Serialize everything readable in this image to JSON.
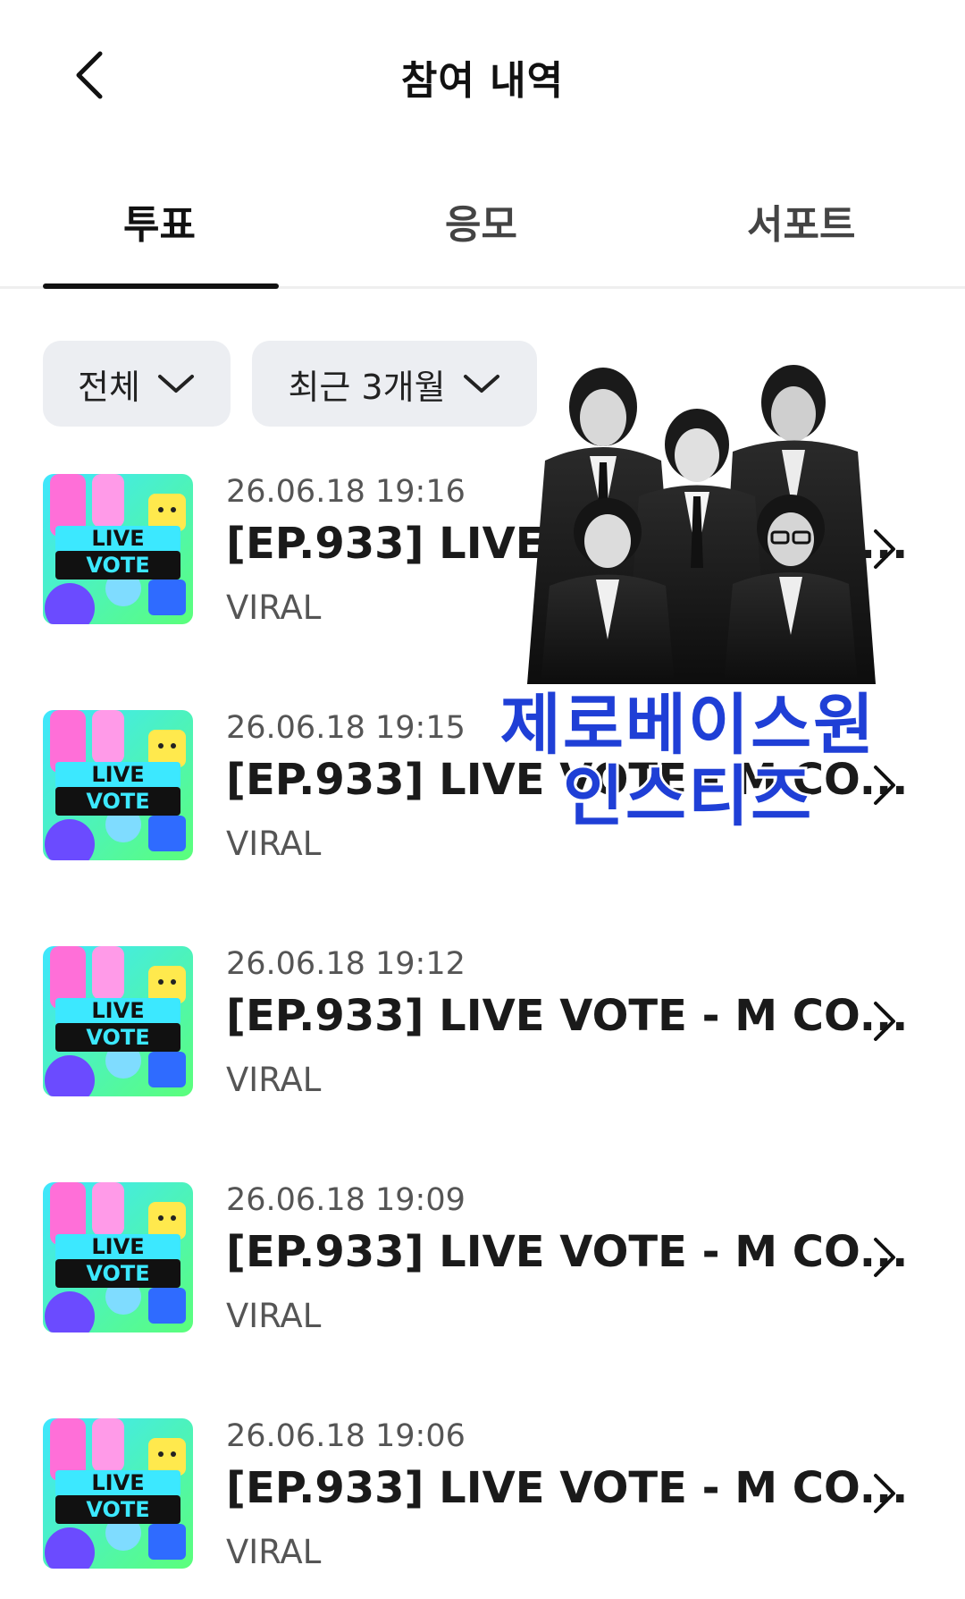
{
  "header": {
    "title": "참여 내역",
    "back_icon": "chevron-left-icon"
  },
  "tabs": [
    {
      "label": "투표",
      "active": true
    },
    {
      "label": "응모",
      "active": false
    },
    {
      "label": "서포트",
      "active": false
    }
  ],
  "filters": {
    "category": "전체",
    "period": "최근 3개월",
    "dropdown_icon": "chevron-down-icon"
  },
  "items": [
    {
      "date": "26.06.18 19:16",
      "title": "[EP.933] LIVE VOTE - M CO...",
      "subtitle": "VIRAL",
      "thumb_line1": "LIVE",
      "thumb_line2": "VOTE"
    },
    {
      "date": "26.06.18 19:15",
      "title": "[EP.933] LIVE VOTE - M CO...",
      "subtitle": "VIRAL",
      "thumb_line1": "LIVE",
      "thumb_line2": "VOTE"
    },
    {
      "date": "26.06.18 19:12",
      "title": "[EP.933] LIVE VOTE - M CO...",
      "subtitle": "VIRAL",
      "thumb_line1": "LIVE",
      "thumb_line2": "VOTE"
    },
    {
      "date": "26.06.18 19:09",
      "title": "[EP.933] LIVE VOTE - M CO...",
      "subtitle": "VIRAL",
      "thumb_line1": "LIVE",
      "thumb_line2": "VOTE"
    },
    {
      "date": "26.06.18 19:06",
      "title": "[EP.933] LIVE VOTE - M CO...",
      "subtitle": "VIRAL",
      "thumb_line1": "LIVE",
      "thumb_line2": "VOTE"
    }
  ],
  "promo": {
    "caption_line1": "제로베이스원",
    "caption_line2": "인스티즈"
  },
  "colors": {
    "tab_indicator": "#111111",
    "chip_bg": "#eceef2",
    "promo_text": "#1f3fd6",
    "thumb_gradient_start": "#3ee6ff",
    "thumb_gradient_end": "#5bff7a"
  }
}
